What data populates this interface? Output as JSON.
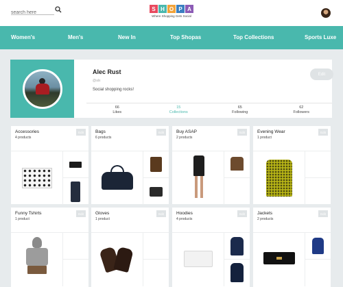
{
  "search": {
    "placeholder": "search here"
  },
  "brand": {
    "letters": [
      "S",
      "H",
      "O",
      "P",
      "A"
    ],
    "letter_colors": [
      "#e84a5f",
      "#49b8ad",
      "#f2a33a",
      "#3a7fc1",
      "#8c5bb5"
    ],
    "tagline": "Where Shopping Gets Social"
  },
  "nav": {
    "items": [
      "Women's",
      "Men's",
      "New In",
      "Top Shopas",
      "Top Collections",
      "Sports Luxe"
    ]
  },
  "profile": {
    "name": "Alec Rust",
    "handle": "@alx",
    "bio": "Social shopping rocks!",
    "edit_label": "Edit",
    "stats": [
      {
        "value": "66",
        "label": "Likes"
      },
      {
        "value": "15",
        "label": "Collections"
      },
      {
        "value": "65",
        "label": "Following"
      },
      {
        "value": "62",
        "label": "Followers"
      }
    ]
  },
  "collections": [
    {
      "title": "Accessories",
      "count": "4 products",
      "edit": "Edit"
    },
    {
      "title": "Bags",
      "count": "6 products",
      "edit": "Edit"
    },
    {
      "title": "Buy ASAP",
      "count": "2 products",
      "edit": "Edit"
    },
    {
      "title": "Evening Wear",
      "count": "1 product",
      "edit": "Edit"
    },
    {
      "title": "Funny Tshirts",
      "count": "1 product",
      "edit": "Edit"
    },
    {
      "title": "Gloves",
      "count": "1 product",
      "edit": "Edit"
    },
    {
      "title": "Hoodies",
      "count": "4 products",
      "edit": "Edit"
    },
    {
      "title": "Jackets",
      "count": "2 products",
      "edit": "Edit"
    }
  ],
  "colors": {
    "accent": "#49b8ad",
    "background": "#e7ebed"
  }
}
